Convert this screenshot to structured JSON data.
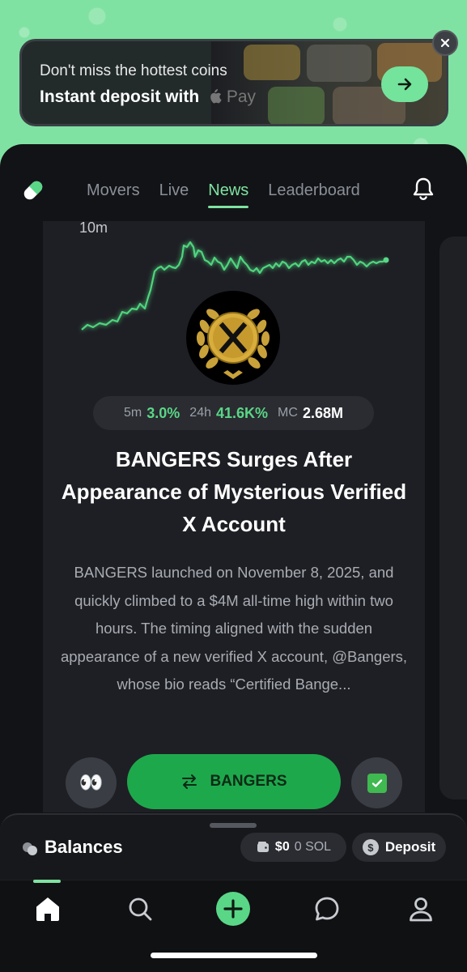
{
  "banner": {
    "title": "Don't miss the hottest coins",
    "subtitle": "Instant deposit with",
    "pay_label": "Pay"
  },
  "tabs": [
    {
      "label": "Movers",
      "active": false
    },
    {
      "label": "Live",
      "active": false
    },
    {
      "label": "News",
      "active": true
    },
    {
      "label": "Leaderboard",
      "active": false
    }
  ],
  "chart": {
    "ylabel": "10m"
  },
  "stats": {
    "m5_label": "5m",
    "m5_value": "3.0%",
    "h24_label": "24h",
    "h24_value": "41.6K%",
    "mc_label": "MC",
    "mc_value": "2.68M"
  },
  "article": {
    "headline": "BANGERS Surges After Appearance of Mysterious Verified X Account",
    "body": "BANGERS launched on November 8, 2025, and quickly climbed to a $4M all-time high within two hours. The timing aligned with the sudden appearance of a new verified X account, @Bangers, whose bio reads “Certified Bange..."
  },
  "actions": {
    "eyes_emoji": "👀",
    "trade_label": "BANGERS"
  },
  "balances": {
    "title": "Balances",
    "usd": "$0",
    "sol": "0 SOL",
    "deposit_label": "Deposit"
  },
  "colors": {
    "accent": "#7ee3a1",
    "positive": "#5ad687",
    "button": "#1ea84c"
  },
  "nav": [
    "home-icon",
    "search-icon",
    "add-icon",
    "chat-icon",
    "profile-icon"
  ]
}
